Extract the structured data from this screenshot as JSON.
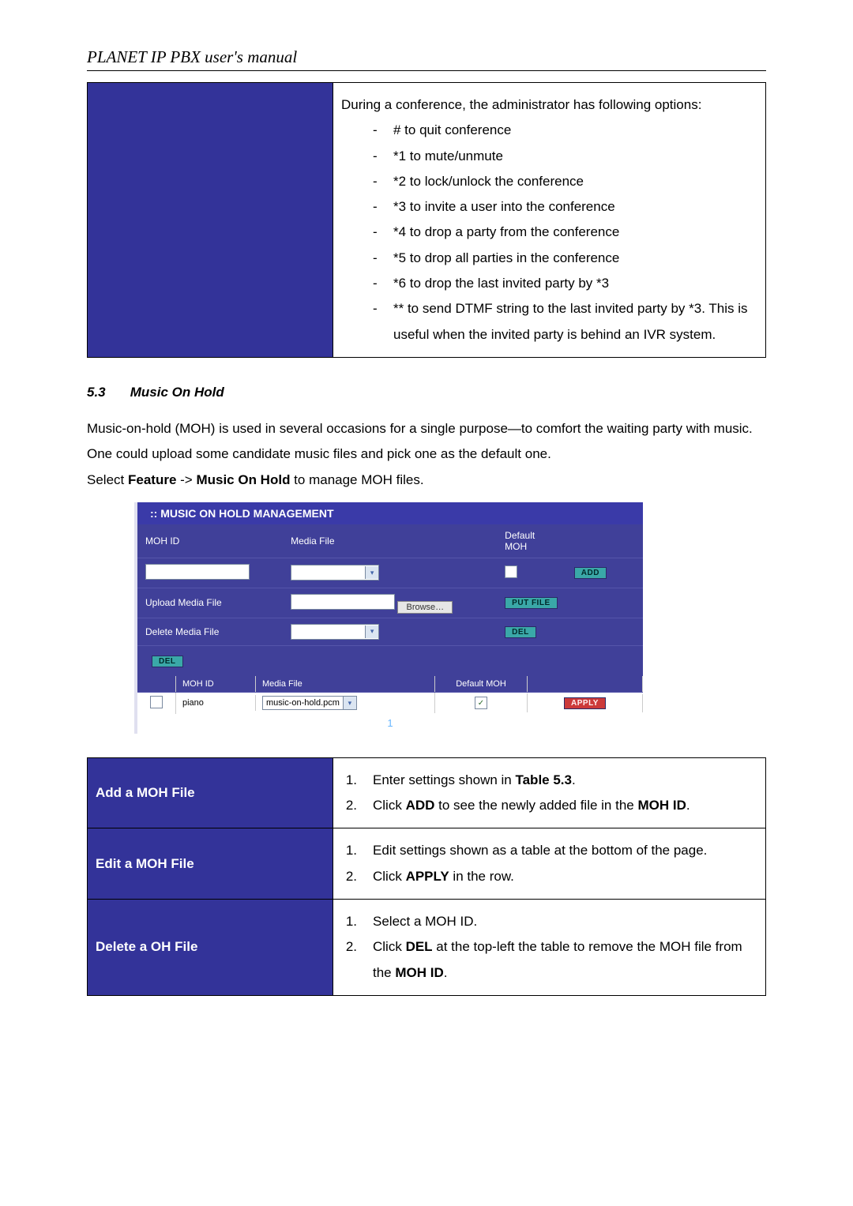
{
  "header": "PLANET IP PBX user's manual",
  "conf": {
    "intro": "During a conference, the administrator has following options:",
    "items": [
      "# to quit conference",
      "*1 to mute/unmute",
      "*2 to lock/unlock the conference",
      "*3 to invite a user into the conference",
      "*4 to drop a party from the conference",
      "*5 to drop all parties in the conference",
      "*6 to drop the last invited party by *3",
      "** to send DTMF string to the last invited party by *3. This is useful when the invited party is behind an IVR system."
    ]
  },
  "section": {
    "num": "5.3",
    "title": "Music On Hold"
  },
  "para1": "Music-on-hold (MOH) is used in several occasions for a single purpose—to comfort the waiting party with music. One could upload some candidate music files and pick one as the default one.",
  "para2a": "Select ",
  "para2b": "Feature",
  "para2c": " -> ",
  "para2d": "Music On Hold",
  "para2e": " to manage MOH files.",
  "shot": {
    "title": ":: MUSIC ON HOLD MANAGEMENT",
    "labels": {
      "mohid": "MOH ID",
      "media": "Media File",
      "default": "Default MOH",
      "upload": "Upload Media File",
      "delete": "Delete Media File"
    },
    "buttons": {
      "add": "ADD",
      "putfile": "PUT FILE",
      "del": "DEL",
      "browse": "Browse…",
      "apply": "APPLY"
    },
    "table": {
      "checked": "✓",
      "id": "piano",
      "mediafile": "music-on-hold.pcm",
      "pager": "1"
    }
  },
  "proc": [
    {
      "label": "Add a MOH File",
      "steps": [
        {
          "pre": "Enter settings shown in ",
          "b1": "Table 5.3",
          "post": "."
        },
        {
          "pre": "Click ",
          "b1": "ADD",
          "mid": " to see the newly added file in the ",
          "b2": "MOH ID",
          "post": "."
        }
      ]
    },
    {
      "label": "Edit a MOH File",
      "steps": [
        {
          "pre": "Edit settings shown as a table at the bottom of the page."
        },
        {
          "pre": "Click ",
          "b1": "APPLY",
          "post": " in the row."
        }
      ]
    },
    {
      "label": "Delete a OH File",
      "steps": [
        {
          "pre": "Select a MOH ID."
        },
        {
          "pre": "Click ",
          "b1": "DEL",
          "mid": " at the top-left the table to remove the MOH file from the ",
          "b2": "MOH ID",
          "post": "."
        }
      ]
    }
  ]
}
